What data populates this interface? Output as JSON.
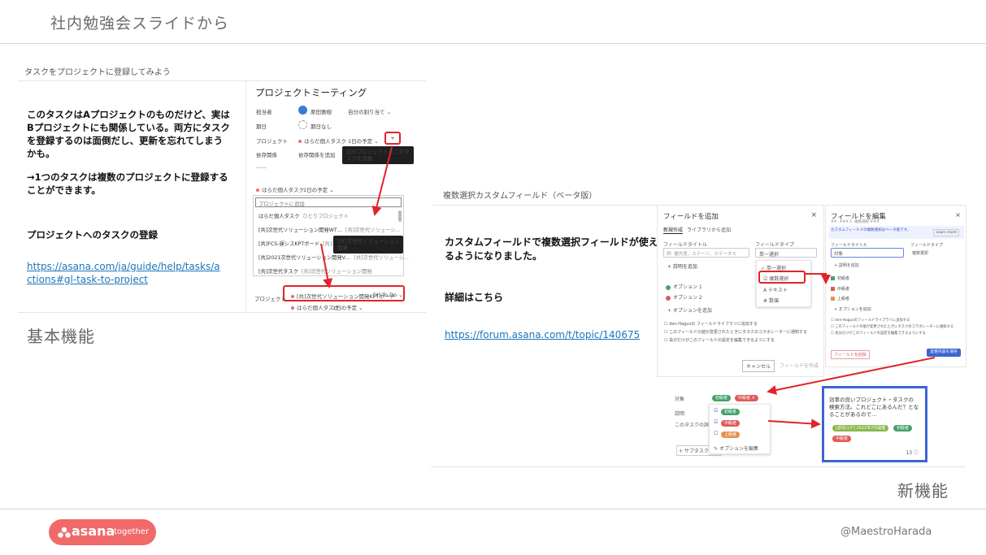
{
  "slide": {
    "title": "社内勉強会スライドから",
    "handle": "@MaestroHarada"
  },
  "left": {
    "subtitle": "タスクをプロジェクトに登録してみよう",
    "para1": [
      "このタスクはAプロジェクトのものだけど、実は",
      "Bプロジェクトにも関係している。両方にタスク",
      "を登録するのは面倒だし、更新を忘れてしまう",
      "かも。"
    ],
    "para2": [
      "→1つのタスクは複数のプロジェクトに登録する",
      "ことができます。"
    ],
    "para3": "プロジェクトへのタスクの登録",
    "link": [
      "https://asana.com/ja/guide/help/tasks/a",
      "ctions#gl-task-to-project"
    ],
    "footer_label": "基本機能",
    "screenshot": {
      "title": "プロジェクトミーティング",
      "assignee_label": "担当者",
      "assignee_name": "原田雅樹",
      "assignee_note": "自分の割り当て ⌄",
      "due_label": "期日",
      "due_value": "期日なし",
      "project_label": "プロジェクト",
      "project_value": "はらだ個人タスク",
      "project_section": "1日の予定 ⌄",
      "plus": "+",
      "tooltip": [
        "別のプロジェクトにこのタ",
        "スクを追加"
      ],
      "dependency_label": "依存関係",
      "dependency_value": "依存関係を追加",
      "other_label": "一一",
      "project_row2": "はらだ個人タスク",
      "project_row2_section": "1日の予定 ⌄",
      "search_placeholder": "プロジェクトに追加",
      "dropdown": [
        {
          "name": "はらだ個人タスク",
          "note": "ひとりプロジェクト"
        },
        {
          "name": "[共]次世代ソリューション開発WT…",
          "note": "[共]次世代ソリューシ…"
        },
        {
          "name": "[共]FCS-遅シスKPTボード",
          "note": "[共]次世"
        },
        {
          "name": "[共]2021次世代ソリューション開発V…",
          "note": "[共]次世代ソリューシ…"
        },
        {
          "name": "[共]次世代タスク",
          "note": "[共]次世代ソリューション開発"
        }
      ],
      "dropdown_tooltip": [
        "[共]次世代ソリューション",
        "開発"
      ],
      "bottom_label": "プロジェクト",
      "bottom_project": "[共]次世代ソリューション開発KPTボード",
      "bottom_section": "[Y] To Do ⌄",
      "bottom_project2": "はらだ個人タスク",
      "bottom_section2": "1日の予定 ⌄"
    }
  },
  "right": {
    "subtitle": "複数選択カスタムフィールド（ベータ版）",
    "para1": [
      "カスタムフィールドで複数選択フィールドが使え",
      "るようになりました。"
    ],
    "para2": "詳細はこちら",
    "link": "https://forum.asana.com/t/topic/140675",
    "footer_label": "新機能",
    "add_field": {
      "title": "フィールドを追加",
      "close": "×",
      "tab1": "新規作成",
      "tab2": "ライブラリから追加",
      "field_title_label": "フィールドタイトル",
      "field_title_placeholder": "例: 優先度、ステージ、ステータス",
      "field_type_label": "フィールドタイプ",
      "field_type_value": "単一選択",
      "add_desc": "+ 説明を追加",
      "options": [
        "オプション 1",
        "オプション 2"
      ],
      "add_option": "+ オプションを追加",
      "type_menu": [
        "単一選択",
        "複数選択",
        "テキスト",
        "数値"
      ],
      "checks": [
        "den-Haguxの フィールドライブラリに追加する",
        "このフィールドの値が変更されたときにタスクのコラボレーターに通知する",
        "長分だけがこのフィールドの設定を編集できるようにする"
      ],
      "cancel": "キャンセル",
      "create": "フィールドを作成"
    },
    "edit_field": {
      "title": "フィールドを編集",
      "subtitle": "##- ###.1. 複数選択 ###",
      "info": "カスタムフィールドの複数選択はベータ版です。",
      "learn": "Learn more",
      "title_label": "フィールドタイトル",
      "title_value": "対象",
      "type_label": "フィールドタイプ",
      "type_value": "複数選択",
      "add_desc": "+ 説明を追加",
      "options": [
        "初級者",
        "中級者",
        "上級者"
      ],
      "add_option": "+ オプションを追加",
      "checks": [
        "den-Haguxのフィールドライブラリに追加する",
        "このフィールドの値が変更されたときにタスクのコラボレーターに通知する",
        "長分だけがこのフィールドの設定を編集できるようにする"
      ],
      "delete": "フィールドを削除",
      "save": "変更内容を保存"
    },
    "task_fields": {
      "target_label": "対象",
      "status_label": "説明",
      "detail_label": "このタスクの詳細",
      "subtask_label": "+ サブタスクを追",
      "chips": [
        "初級者",
        "中級者 ×"
      ],
      "menu": [
        "初級者",
        "中級者",
        "上級者"
      ],
      "edit_options": "オプションを編集"
    },
    "search_card": {
      "text": [
        "効率の良いプロジェクト・タスクの",
        "検索方法。これどこにあるんだ？とな",
        "ることがあるので…"
      ],
      "tag1": "[返信ログ] 2021年7月開催",
      "tag2": "初級者",
      "tag3": "中級者",
      "count": "13 ⓘ"
    }
  },
  "logo": {
    "word": "asana",
    "sub": "together"
  },
  "colors": {
    "accent_red": "#e0242b",
    "asana_coral": "#f06a6a",
    "link_blue": "#1b75bb"
  }
}
